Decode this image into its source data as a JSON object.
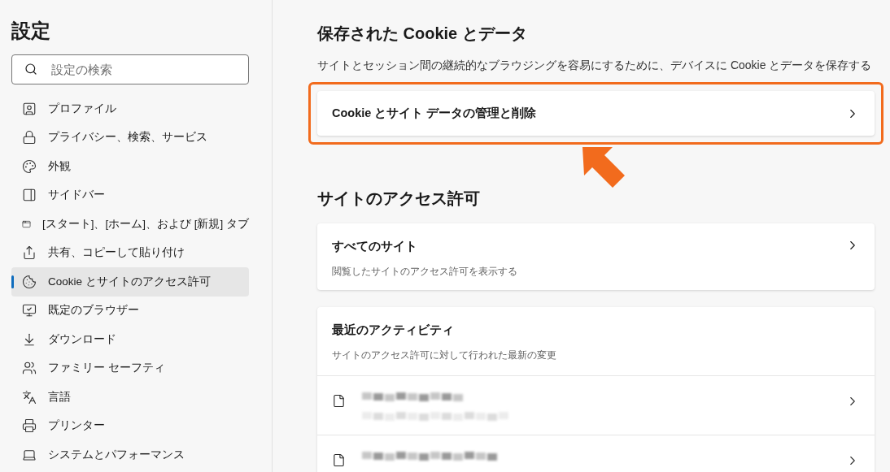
{
  "sidebar": {
    "title": "設定",
    "search": {
      "placeholder": "設定の検索"
    },
    "items": [
      {
        "kind": "profile",
        "label": "プロファイル",
        "selected": false
      },
      {
        "kind": "privacy",
        "label": "プライバシー、検索、サービス",
        "selected": false
      },
      {
        "kind": "appearance",
        "label": "外観",
        "selected": false
      },
      {
        "kind": "sidebar",
        "label": "サイドバー",
        "selected": false
      },
      {
        "kind": "newtab",
        "label": "[スタート]、[ホーム]、および [新規] タブ",
        "selected": false
      },
      {
        "kind": "share",
        "label": "共有、コピーして貼り付け",
        "selected": false
      },
      {
        "kind": "cookie",
        "label": "Cookie とサイトのアクセス許可",
        "selected": true
      },
      {
        "kind": "browser",
        "label": "既定のブラウザー",
        "selected": false
      },
      {
        "kind": "download",
        "label": "ダウンロード",
        "selected": false
      },
      {
        "kind": "family",
        "label": "ファミリー セーフティ",
        "selected": false
      },
      {
        "kind": "language",
        "label": "言語",
        "selected": false
      },
      {
        "kind": "printer",
        "label": "プリンター",
        "selected": false
      },
      {
        "kind": "system",
        "label": "システムとパフォーマンス",
        "selected": false
      }
    ]
  },
  "cookies": {
    "heading": "保存された Cookie とデータ",
    "description": "サイトとセッション間の継続的なブラウジングを容易にするために、デバイスに Cookie とデータを保存する",
    "link": "Cookie とサイト データの管理と削除"
  },
  "permissions": {
    "heading": "サイトのアクセス許可",
    "all_sites": {
      "title": "すべてのサイト",
      "subtitle": "閲覧したサイトのアクセス許可を表示する"
    },
    "recent": {
      "title": "最近のアクティビティ",
      "subtitle": "サイトのアクセス許可に対して行われた最新の変更"
    }
  }
}
